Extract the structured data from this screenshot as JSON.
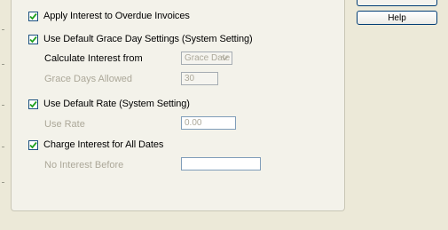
{
  "options": {
    "apply_overdue": {
      "label": "Apply Interest to Overdue Invoices",
      "checked": true
    },
    "default_grace": {
      "label": "Use Default Grace Day Settings (System Setting)",
      "checked": true
    },
    "calc_from": {
      "label": "Calculate Interest from",
      "value": "Grace Date"
    },
    "grace_days": {
      "label": "Grace Days Allowed",
      "value": "30"
    },
    "default_rate": {
      "label": "Use Default Rate (System Setting)",
      "checked": true
    },
    "use_rate": {
      "label": "Use Rate",
      "value": "0.00"
    },
    "all_dates": {
      "label": "Charge Interest for All Dates",
      "checked": true
    },
    "no_interest_before": {
      "label": "No Interest Before",
      "value": ""
    }
  },
  "buttons": {
    "help": "Help"
  },
  "colors": {
    "check": "#21a121",
    "disabled_text": "#aca899"
  }
}
